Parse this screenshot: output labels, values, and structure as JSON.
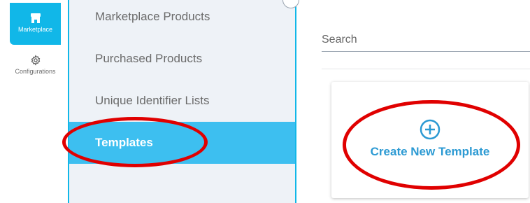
{
  "rail": {
    "marketplace_label": "Marketplace",
    "configurations_label": "Configurations"
  },
  "subnav": {
    "items": [
      {
        "label": "Marketplace Products",
        "active": false
      },
      {
        "label": "Purchased Products",
        "active": false
      },
      {
        "label": "Unique Identifier Lists",
        "active": false
      },
      {
        "label": "Templates",
        "active": true
      }
    ]
  },
  "search": {
    "placeholder": "Search"
  },
  "create_card": {
    "label": "Create New Template",
    "icon": "plus-circle-icon"
  },
  "colors": {
    "accent": "#11b7e8",
    "active_item": "#3dbff0",
    "link_blue": "#2c9ad3",
    "annotation_red": "#e00000"
  }
}
